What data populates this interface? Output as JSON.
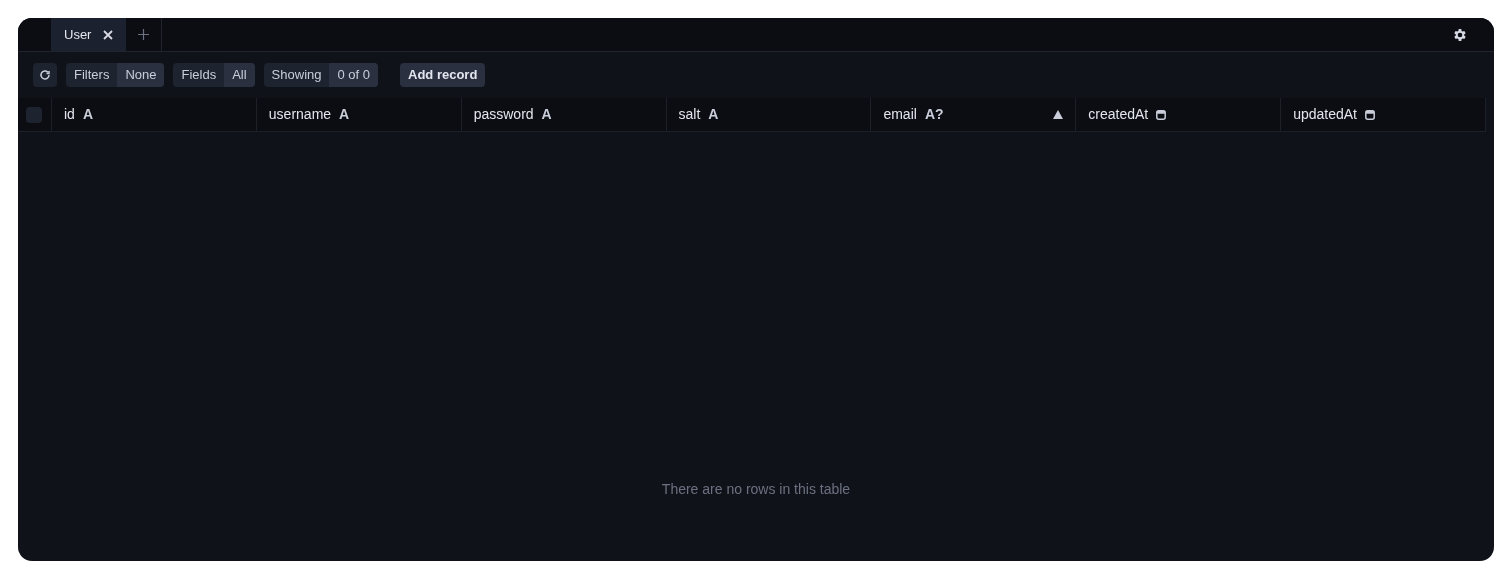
{
  "tabs": [
    {
      "label": "User",
      "selected": true
    }
  ],
  "toolbar": {
    "filters": {
      "label": "Filters",
      "value": "None"
    },
    "fields": {
      "label": "Fields",
      "value": "All"
    },
    "showing": {
      "label": "Showing",
      "value": "0 of 0"
    },
    "add_button": "Add record"
  },
  "table": {
    "select_all_checked": false,
    "columns": [
      {
        "name": "id",
        "kind": "text",
        "type": "A",
        "sorted": false
      },
      {
        "name": "username",
        "kind": "text",
        "type": "A",
        "sorted": false
      },
      {
        "name": "password",
        "kind": "text",
        "type": "A",
        "sorted": false
      },
      {
        "name": "salt",
        "kind": "text",
        "type": "A",
        "sorted": false
      },
      {
        "name": "email",
        "kind": "text",
        "type": "A?",
        "sorted": true
      },
      {
        "name": "createdAt",
        "kind": "datetime",
        "sorted": false
      },
      {
        "name": "updatedAt",
        "kind": "datetime",
        "sorted": false
      }
    ],
    "empty_message": "There are no rows in this table"
  }
}
